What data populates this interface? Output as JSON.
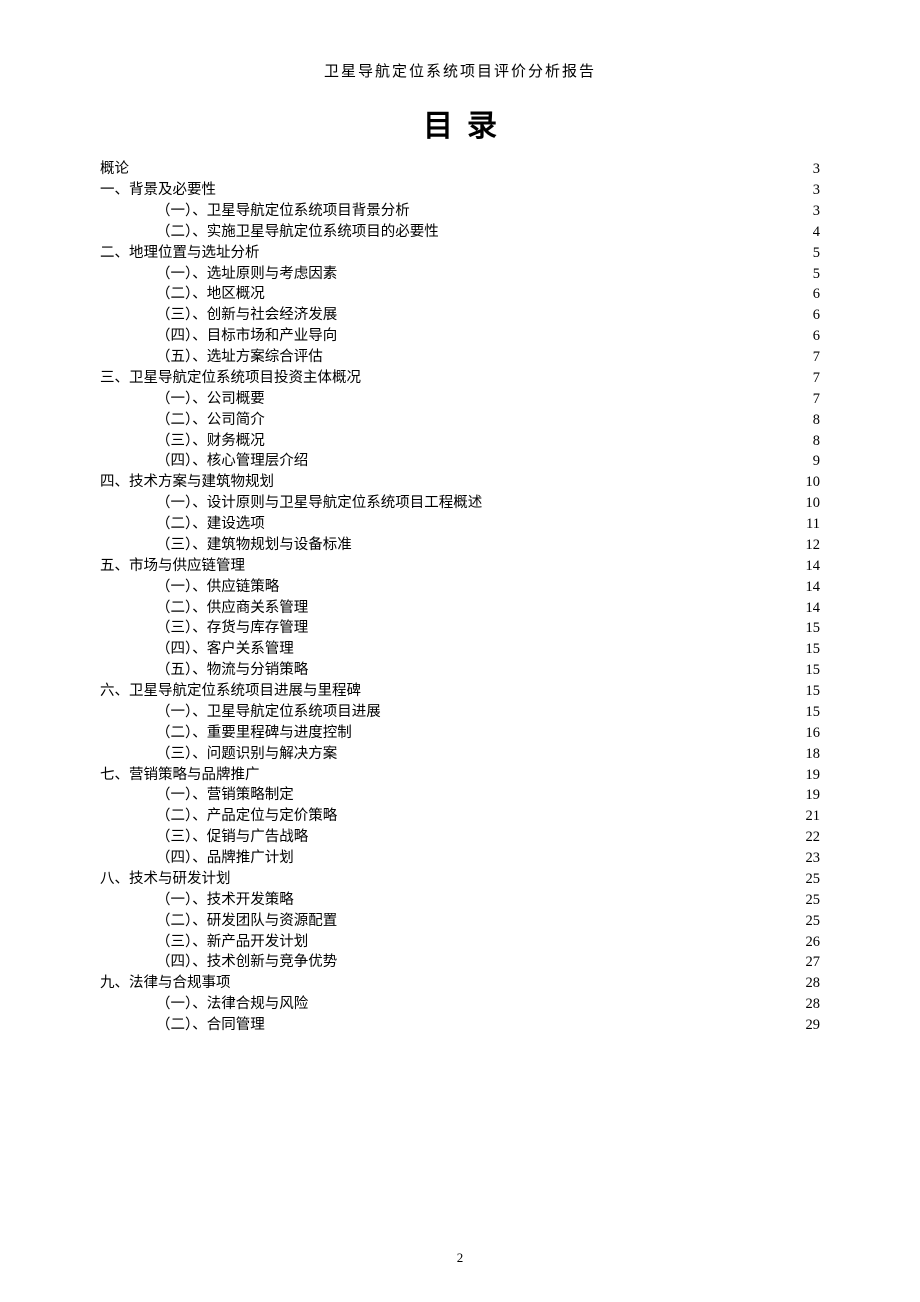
{
  "header": "卫星导航定位系统项目评价分析报告",
  "toc_title": "目录",
  "page_number": "2",
  "toc": [
    {
      "level": 1,
      "label": "概论",
      "page": "3"
    },
    {
      "level": 1,
      "label": "一、背景及必要性",
      "page": "3"
    },
    {
      "level": 2,
      "label": "（一）、卫星导航定位系统项目背景分析",
      "page": "3"
    },
    {
      "level": 2,
      "label": "（二）、实施卫星导航定位系统项目的必要性",
      "page": "4"
    },
    {
      "level": 1,
      "label": "二、地理位置与选址分析",
      "page": "5"
    },
    {
      "level": 2,
      "label": "（一）、选址原则与考虑因素",
      "page": "5"
    },
    {
      "level": 2,
      "label": "（二）、地区概况",
      "page": "6"
    },
    {
      "level": 2,
      "label": "（三）、创新与社会经济发展",
      "page": "6"
    },
    {
      "level": 2,
      "label": "（四）、目标市场和产业导向",
      "page": "6"
    },
    {
      "level": 2,
      "label": "（五）、选址方案综合评估",
      "page": "7"
    },
    {
      "level": 1,
      "label": "三、卫星导航定位系统项目投资主体概况",
      "page": "7"
    },
    {
      "level": 2,
      "label": "（一）、公司概要",
      "page": "7"
    },
    {
      "level": 2,
      "label": "（二）、公司简介",
      "page": "8"
    },
    {
      "level": 2,
      "label": "（三）、财务概况",
      "page": "8"
    },
    {
      "level": 2,
      "label": "（四）、核心管理层介绍",
      "page": "9"
    },
    {
      "level": 1,
      "label": "四、技术方案与建筑物规划",
      "page": "10"
    },
    {
      "level": 2,
      "label": "（一）、设计原则与卫星导航定位系统项目工程概述",
      "page": "10"
    },
    {
      "level": 2,
      "label": "（二）、建设选项",
      "page": "11"
    },
    {
      "level": 2,
      "label": "（三）、建筑物规划与设备标准",
      "page": "12"
    },
    {
      "level": 1,
      "label": "五、市场与供应链管理",
      "page": "14"
    },
    {
      "level": 2,
      "label": "（一）、供应链策略",
      "page": "14"
    },
    {
      "level": 2,
      "label": "（二）、供应商关系管理",
      "page": "14"
    },
    {
      "level": 2,
      "label": "（三）、存货与库存管理",
      "page": "15"
    },
    {
      "level": 2,
      "label": "（四）、客户关系管理",
      "page": "15"
    },
    {
      "level": 2,
      "label": "（五）、物流与分销策略",
      "page": "15"
    },
    {
      "level": 1,
      "label": "六、卫星导航定位系统项目进展与里程碑",
      "page": "15"
    },
    {
      "level": 2,
      "label": "（一）、卫星导航定位系统项目进展",
      "page": "15"
    },
    {
      "level": 2,
      "label": "（二）、重要里程碑与进度控制",
      "page": "16"
    },
    {
      "level": 2,
      "label": "（三）、问题识别与解决方案",
      "page": "18"
    },
    {
      "level": 1,
      "label": "七、营销策略与品牌推广",
      "page": "19"
    },
    {
      "level": 2,
      "label": "（一）、营销策略制定",
      "page": "19"
    },
    {
      "level": 2,
      "label": "（二）、产品定位与定价策略",
      "page": "21"
    },
    {
      "level": 2,
      "label": "（三）、促销与广告战略",
      "page": "22"
    },
    {
      "level": 2,
      "label": "（四）、品牌推广计划",
      "page": "23"
    },
    {
      "level": 1,
      "label": "八、技术与研发计划",
      "page": "25"
    },
    {
      "level": 2,
      "label": "（一）、技术开发策略",
      "page": "25"
    },
    {
      "level": 2,
      "label": "（二）、研发团队与资源配置",
      "page": "25"
    },
    {
      "level": 2,
      "label": "（三）、新产品开发计划",
      "page": "26"
    },
    {
      "level": 2,
      "label": "（四）、技术创新与竞争优势",
      "page": "27"
    },
    {
      "level": 1,
      "label": "九、法律与合规事项",
      "page": "28"
    },
    {
      "level": 2,
      "label": "（一）、法律合规与风险",
      "page": "28"
    },
    {
      "level": 2,
      "label": "（二）、合同管理",
      "page": "29"
    }
  ]
}
